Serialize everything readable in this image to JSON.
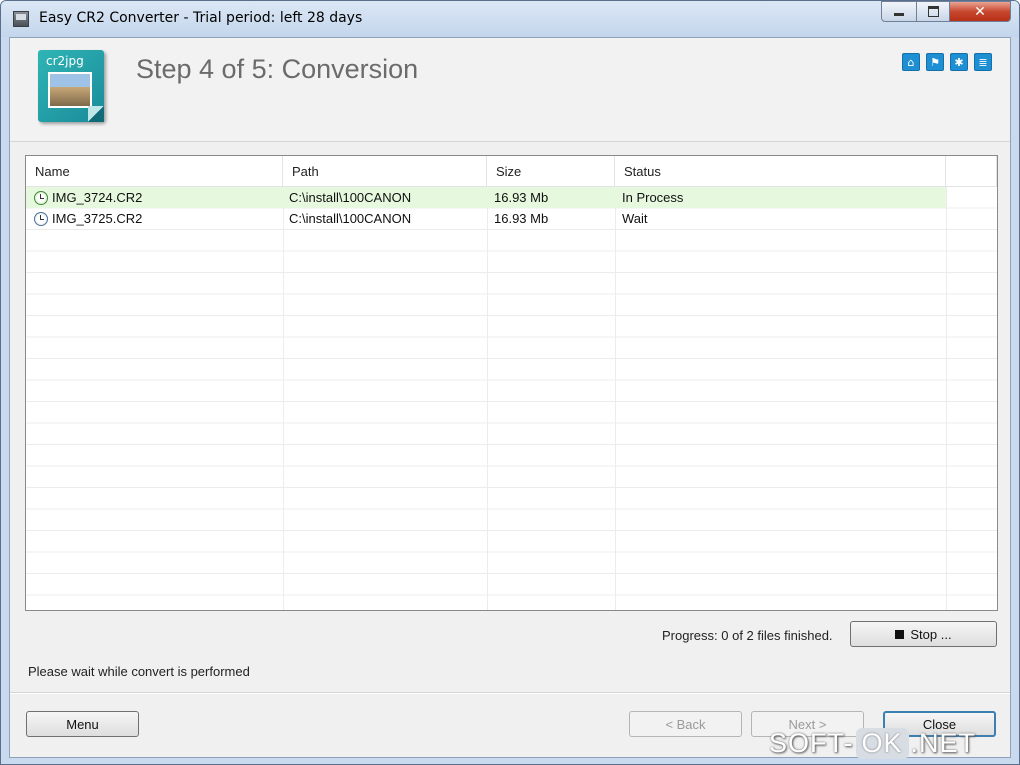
{
  "window": {
    "title": "Easy CR2 Converter - Trial period: left 28 days",
    "controls": {
      "minimize_icon": "minimize-icon",
      "maximize_icon": "maximize-icon",
      "close_glyph": "✕"
    }
  },
  "header": {
    "logo_text": "cr2jpg",
    "step_title": "Step 4 of 5: Conversion",
    "tool_icons": [
      {
        "name": "home-icon",
        "glyph": "⌂"
      },
      {
        "name": "network-icon",
        "glyph": "⚑"
      },
      {
        "name": "settings-icon",
        "glyph": "✱"
      },
      {
        "name": "document-icon",
        "glyph": "≣"
      }
    ]
  },
  "file_list": {
    "columns": [
      "Name",
      "Path",
      "Size",
      "Status"
    ],
    "rows": [
      {
        "name": "IMG_3724.CR2",
        "path": "C:\\install\\100CANON",
        "size": "16.93 Mb",
        "status": "In Process"
      },
      {
        "name": "IMG_3725.CR2",
        "path": "C:\\install\\100CANON",
        "size": "16.93 Mb",
        "status": "Wait"
      }
    ]
  },
  "progress": {
    "text": "Progress: 0 of 2 files finished.",
    "stop_label": "Stop ..."
  },
  "status_message": "Please wait while convert is performed",
  "footer": {
    "menu_label": "Menu",
    "back_label": "< Back",
    "next_label": "Next >",
    "close_label": "Close"
  },
  "watermark": {
    "part1": "SOFT-",
    "part2": "OK",
    "part3": ".NET"
  },
  "colors": {
    "active_row": "#e6f9df",
    "toolbar_icon": "#1f8fd4",
    "title_text": "#6b6b6b"
  }
}
